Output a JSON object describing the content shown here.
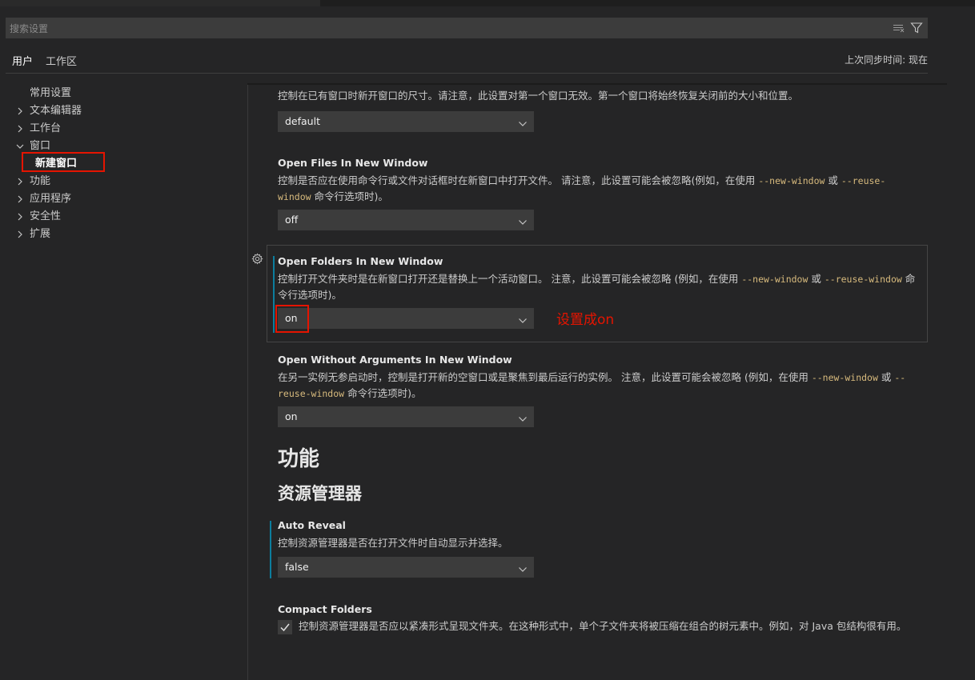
{
  "search": {
    "placeholder": "搜索设置"
  },
  "scope_tabs": [
    {
      "label": "用户"
    },
    {
      "label": "工作区"
    }
  ],
  "sync_status": "上次同步时间: 现在",
  "toc": [
    {
      "label": "常用设置"
    },
    {
      "label": "文本编辑器"
    },
    {
      "label": "工作台"
    },
    {
      "label": "窗口"
    },
    {
      "label": "新建窗口"
    },
    {
      "label": "功能"
    },
    {
      "label": "应用程序"
    },
    {
      "label": "安全性"
    },
    {
      "label": "扩展"
    }
  ],
  "settings": {
    "window_dimensions": {
      "desc": "控制在已有窗口时新开窗口的尺寸。请注意，此设置对第一个窗口无效。第一个窗口将始终恢复关闭前的大小和位置。",
      "value": "default"
    },
    "open_files": {
      "title": "Open Files In New Window",
      "desc_a": "控制是否应在使用命令行或文件对话框时在新窗口中打开文件。 请注意，此设置可能会被忽略(例如，在使用 ",
      "flag1": "--new-window",
      "desc_b": " 或 ",
      "flag2": "--reuse-window",
      "desc_c": " 命令行选项时)。",
      "value": "off"
    },
    "open_folders": {
      "title": "Open Folders In New Window",
      "desc_a": "控制打开文件夹时是在新窗口打开还是替换上一个活动窗口。 注意，此设置可能会被忽略 (例如，在使用 ",
      "flag1": "--new-window",
      "desc_b": " 或 ",
      "flag2": "--reuse-window",
      "desc_c": " 命令行选项时)。",
      "value": "on",
      "annotation": "设置成on"
    },
    "open_without_args": {
      "title": "Open Without Arguments In New Window",
      "desc_a": "在另一实例无参启动时，控制是打开新的空窗口或是聚焦到最后运行的实例。 注意，此设置可能会被忽略 (例如，在使用 ",
      "flag1": "--new-window",
      "desc_b": " 或 ",
      "flag2": "--reuse-window",
      "desc_c": " 命令行选项时)。",
      "value": "on"
    },
    "section_h1": "功能",
    "section_h2": "资源管理器",
    "auto_reveal": {
      "title": "Auto Reveal",
      "desc": "控制资源管理器是否在打开文件时自动显示并选择。",
      "value": "false"
    },
    "compact_folders": {
      "title": "Compact Folders",
      "desc": "控制资源管理器是否应以紧凑形式呈现文件夹。在这种形式中，单个子文件夹将被压缩在组合的树元素中。例如，对 Java 包结构很有用。",
      "checked": true
    }
  },
  "colors": {
    "accent_modified": "#0c7d9d",
    "highlight_red": "#e51400",
    "code_flag": "#d7ba7d"
  },
  "icons": [
    "clear-filter-icon",
    "filter-icon",
    "chevron-right-icon",
    "chevron-down-icon",
    "gear-icon",
    "checkmark-icon"
  ]
}
